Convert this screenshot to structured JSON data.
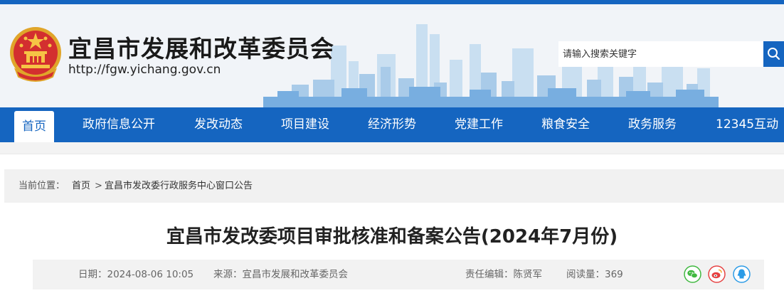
{
  "site": {
    "title": "宜昌市发展和改革委员会",
    "url": "http://fgw.yichang.gov.cn"
  },
  "search": {
    "placeholder": "请输入搜索关键字"
  },
  "nav": {
    "items": [
      {
        "label": "首页",
        "active": true
      },
      {
        "label": "政府信息公开"
      },
      {
        "label": "发改动态"
      },
      {
        "label": "项目建设"
      },
      {
        "label": "经济形势"
      },
      {
        "label": "党建工作"
      },
      {
        "label": "粮食安全"
      },
      {
        "label": "政务服务"
      },
      {
        "label": "12345互动"
      }
    ]
  },
  "breadcrumb": {
    "prefix": "当前位置：",
    "home": "首页",
    "separator": ">",
    "current": "宜昌市发改委行政服务中心窗口公告"
  },
  "article": {
    "title": "宜昌市发改委项目审批核准和备案公告(2024年7月份)",
    "date": "日期：2024-08-06 10:05",
    "source": "来源：宜昌市发展和改革委员会",
    "editor": "责任编辑：陈贤军",
    "views": "阅读量：369"
  },
  "share": {
    "icons": [
      "wechat-icon",
      "weibo-icon",
      "qq-icon"
    ],
    "colors": {
      "wechat": "#3fb83f",
      "weibo": "#e64141",
      "qq": "#2b9be6"
    }
  },
  "colors": {
    "brand": "#1565c0",
    "header_bg": "#f1f4f8"
  }
}
